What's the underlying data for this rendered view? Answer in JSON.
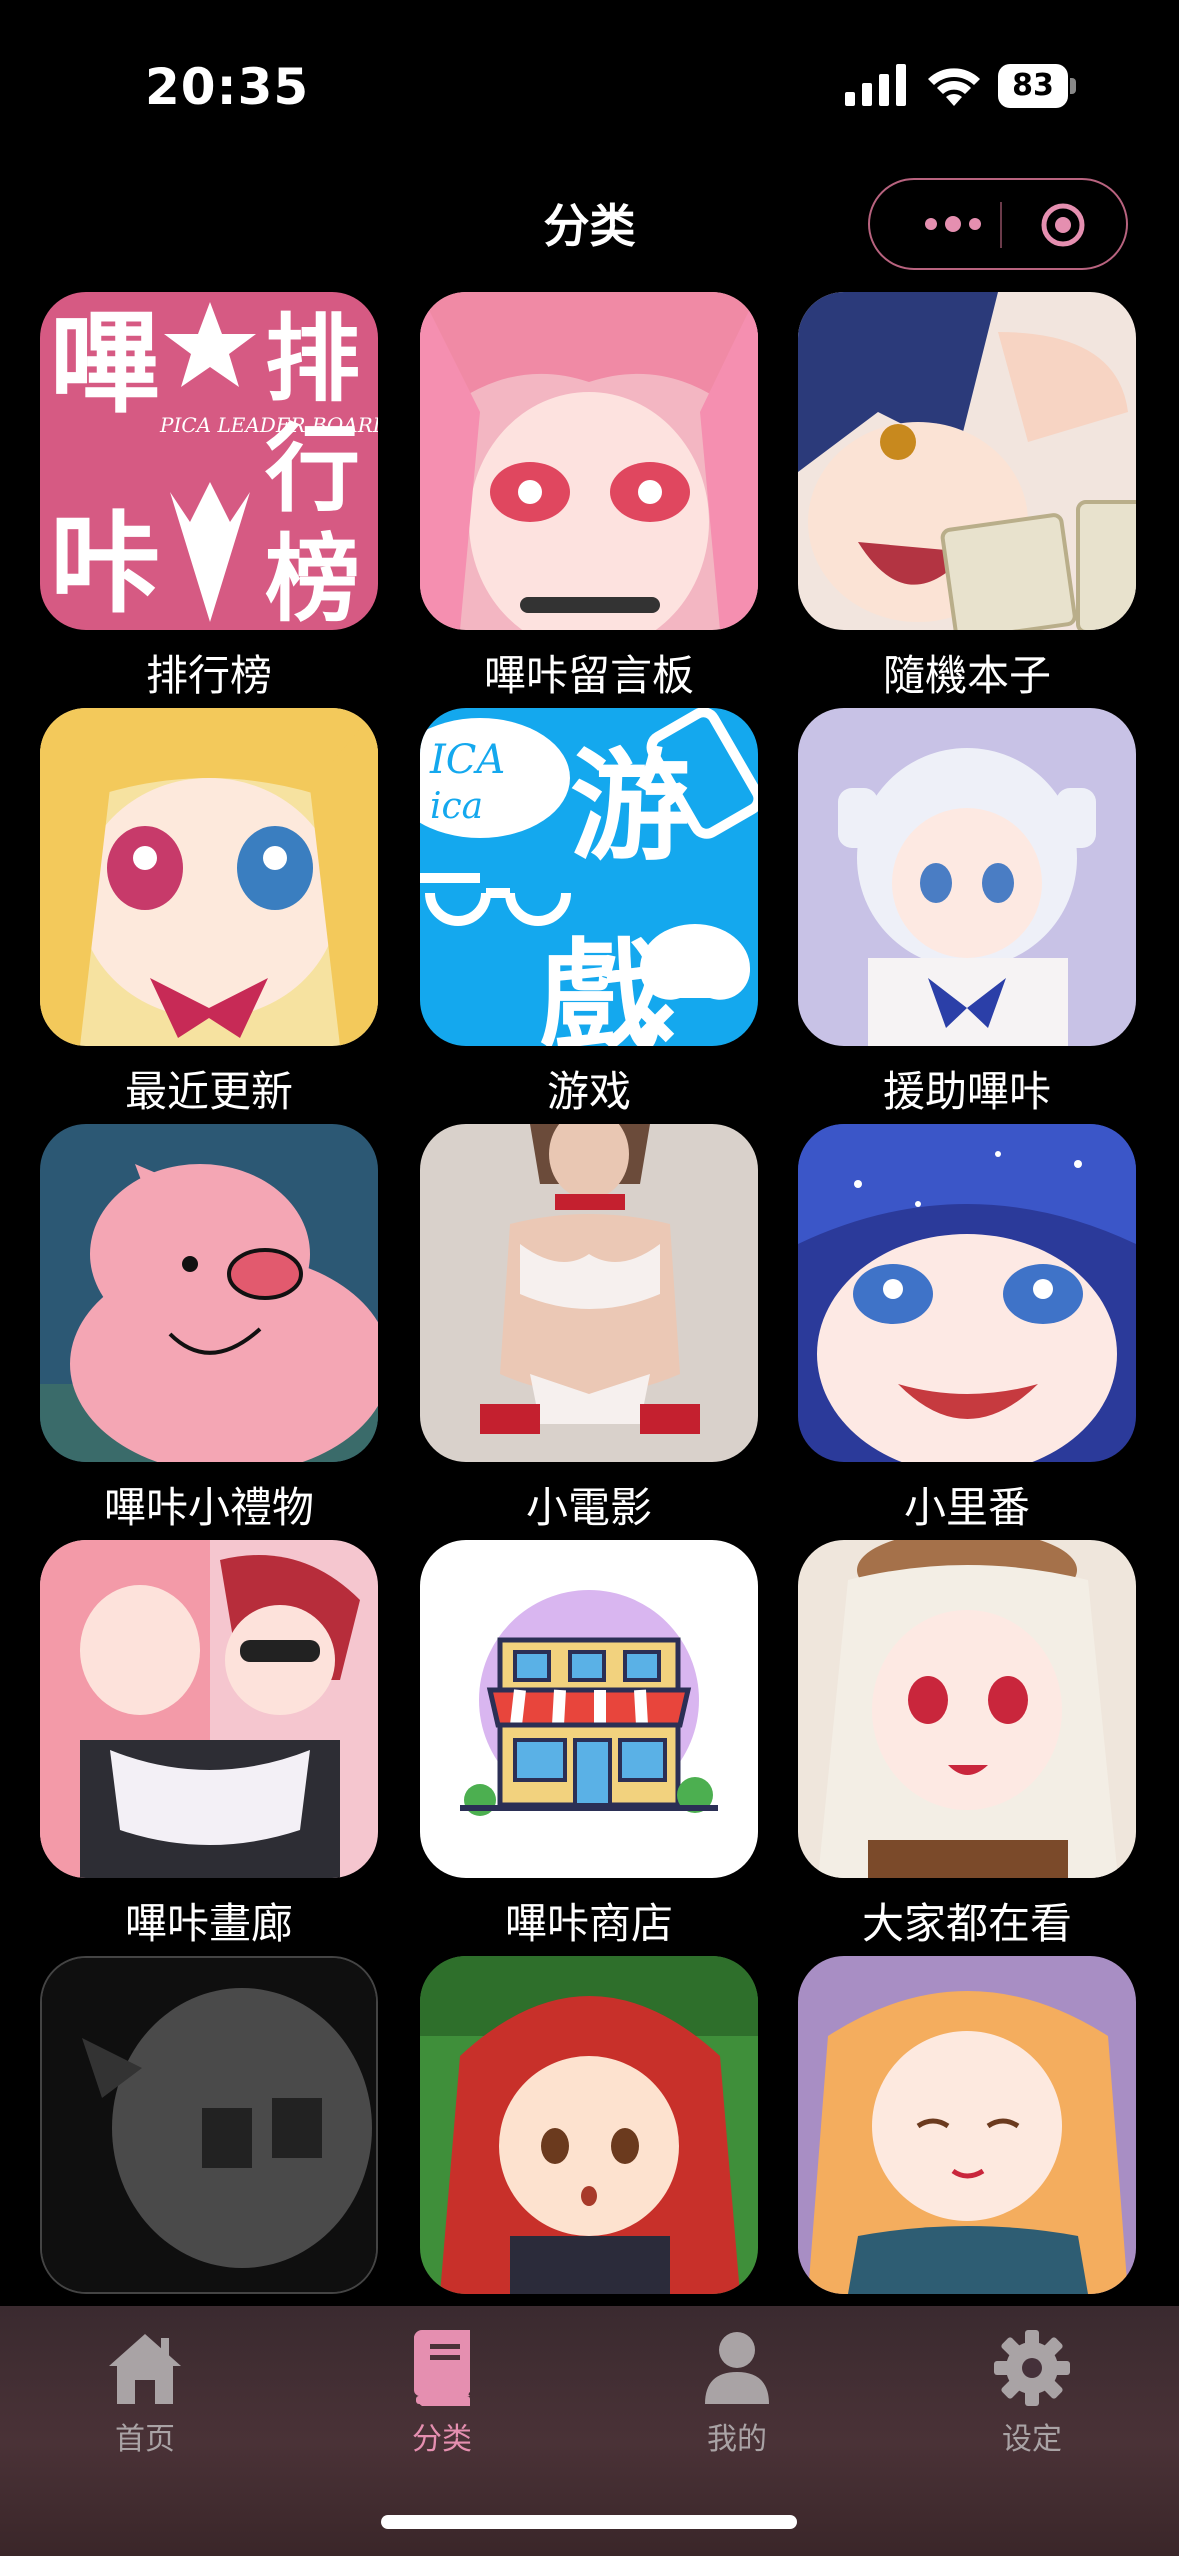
{
  "status": {
    "time": "20:35",
    "battery": "83"
  },
  "nav": {
    "title": "分类",
    "capsule_more": "more-dots",
    "capsule_close": "target-circle"
  },
  "tiles": [
    {
      "label": "排行榜"
    },
    {
      "label": "嗶咔留言板"
    },
    {
      "label": "隨機本子"
    },
    {
      "label": "最近更新"
    },
    {
      "label": "游戏"
    },
    {
      "label": "援助嗶咔"
    },
    {
      "label": "嗶咔小禮物"
    },
    {
      "label": "小電影"
    },
    {
      "label": "小里番"
    },
    {
      "label": "嗶咔畫廊"
    },
    {
      "label": "嗶咔商店"
    },
    {
      "label": "大家都在看"
    },
    {
      "label": ""
    },
    {
      "label": ""
    },
    {
      "label": ""
    }
  ],
  "thumb_text": {
    "ranking_line1": "嗶",
    "ranking_line2": "咔",
    "ranking_col1": "排",
    "ranking_col2": "行",
    "ranking_col3": "榜",
    "ranking_en": "PICA LEADER BOARD",
    "game_en1": "ICA",
    "game_en2": "ica",
    "game_char1": "游",
    "game_char2": "戲"
  },
  "tabbar": [
    {
      "label": "首页",
      "icon": "home-icon"
    },
    {
      "label": "分类",
      "icon": "book-icon"
    },
    {
      "label": "我的",
      "icon": "person-icon"
    },
    {
      "label": "设定",
      "icon": "gear-icon"
    }
  ],
  "colors": {
    "accent": "#e58fb0",
    "inactive": "#a9a3a5",
    "background": "#000000"
  }
}
